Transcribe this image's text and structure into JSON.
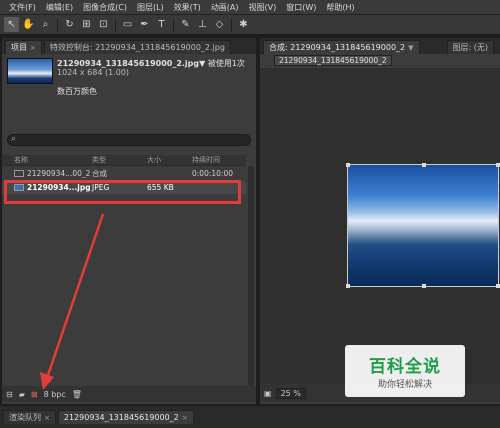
{
  "menu": [
    "文件(F)",
    "编辑(E)",
    "图像合成(C)",
    "图层(L)",
    "效果(T)",
    "动画(A)",
    "视图(V)",
    "窗口(W)",
    "帮助(H)"
  ],
  "project_panel": {
    "tabs": [
      {
        "label": "项目"
      },
      {
        "label": "特效控制台: 21290934_131845619000_2.jpg"
      }
    ],
    "filename": "21290934_131845619000_2.jpg▼",
    "used": "被使用1次",
    "dims": "1024 x 684 (1.00)",
    "colors": "数百万颜色",
    "columns": [
      "名称",
      "类型",
      "大小",
      "持续时间"
    ],
    "rows": [
      {
        "name": "21290934...00_2",
        "type": "合成",
        "size": "",
        "duration": "0:00:10:00"
      },
      {
        "name": "21290934...jpg",
        "type": "JPEG",
        "size": "655 KB",
        "duration": ""
      }
    ],
    "bpc": "8 bpc"
  },
  "comp_panel": {
    "tab": "合成: 21290934_131845619000_2",
    "subtab": "21290934_131845619000_2",
    "layer_tab": "图层: (无)",
    "zoom": "25 %"
  },
  "watermark": {
    "title": "百科全说",
    "subtitle": "助你轻松解决"
  },
  "bottom_tabs": [
    "渲染队列",
    "21290934_131845619000_2"
  ],
  "colors": {
    "highlight": "#e63b3b"
  }
}
